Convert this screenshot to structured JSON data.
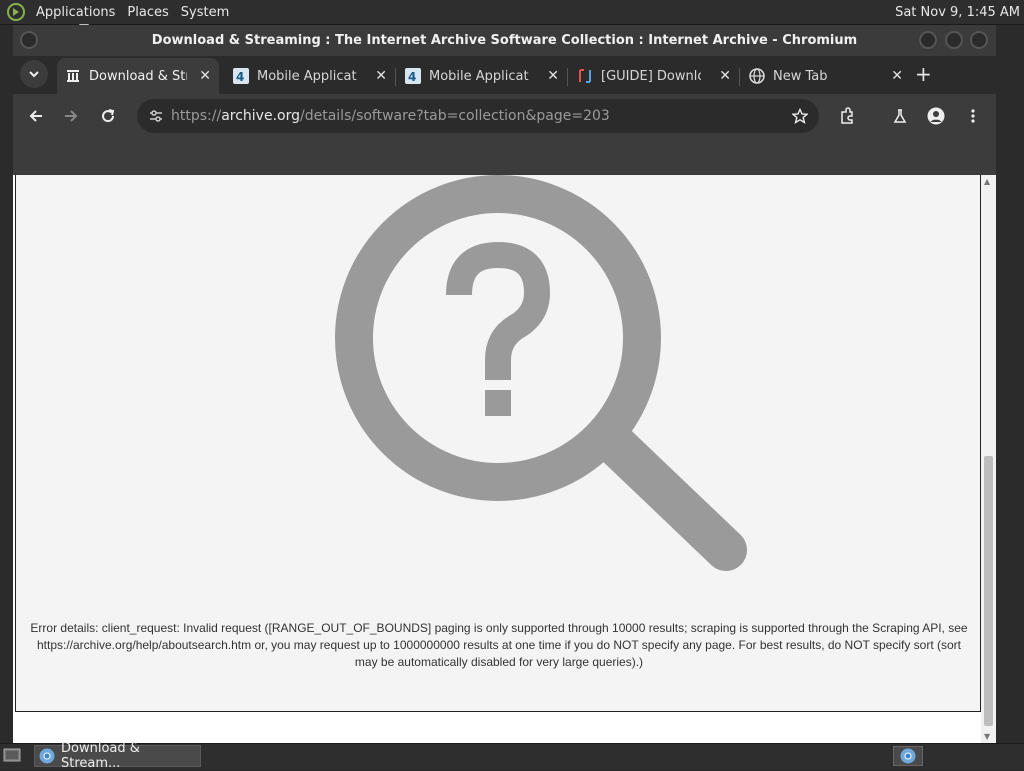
{
  "panel": {
    "menus": [
      "Applications",
      "Places",
      "System"
    ],
    "clock": "Sat Nov 9, 1:45 AM"
  },
  "window": {
    "title": "Download & Streaming : The Internet Archive Software Collection : Internet Archive - Chromium"
  },
  "tabs": [
    {
      "label": "Download & Streaming",
      "icon": "archive-icon",
      "active": true
    },
    {
      "label": "Mobile Applications",
      "icon": "4pda-icon",
      "active": false
    },
    {
      "label": "Mobile Applications",
      "icon": "4pda-icon",
      "active": false
    },
    {
      "label": "[GUIDE] Download",
      "icon": "guide-icon",
      "active": false
    },
    {
      "label": "New Tab",
      "icon": "globe-icon",
      "active": false
    }
  ],
  "address": {
    "scheme": "https://",
    "host": "archive.org",
    "path": "/details/software?tab=collection&page=203"
  },
  "page": {
    "error_text": "Error details: client_request: Invalid request ([RANGE_OUT_OF_BOUNDS] paging is only supported through 10000 results; scraping is supported through the Scraping API, see https://archive.org/help/aboutsearch.htm or, you may request up to 1000000000 results at one time if you do NOT specify any page. For best results, do NOT specify sort (sort may be automatically disabled for very large queries).)",
    "illustration_color": "#9a9a9a",
    "scroll_fraction": 0.62
  },
  "taskbar": {
    "item_label": "Download & Stream..."
  }
}
